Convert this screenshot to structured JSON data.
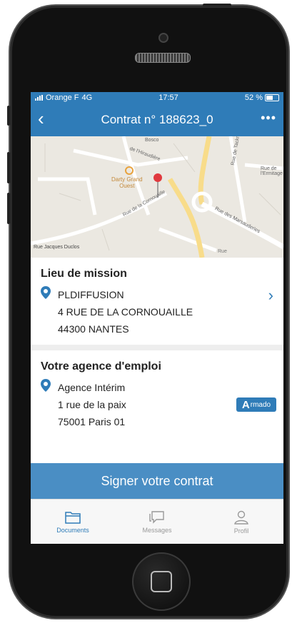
{
  "status_bar": {
    "carrier": "Orange F",
    "network": "4G",
    "time": "17:57",
    "battery": "52 %"
  },
  "header": {
    "title": "Contrat n° 188623_0",
    "more": "•••"
  },
  "map_labels": {
    "poi": "Darty Grand\nOuest",
    "street1": "Rue de la Cornouaille",
    "street2": "Rue des Marsauderies",
    "street3": "Rue de Tackrc",
    "street4": "Rue de l'Ermitage",
    "street5": "Rue Jacques Duclos",
    "street6": "de l'Hiraudière",
    "street7": "Rue de la Cornouaille",
    "street8": "Rue",
    "area": "Bosco"
  },
  "mission": {
    "heading": "Lieu de mission",
    "line1": "PLDIFFUSION",
    "line2": "4 RUE DE LA CORNOUAILLE",
    "line3": "44300 NANTES"
  },
  "agency": {
    "heading": "Votre agence d'emploi",
    "line1": "Agence Intérim",
    "line2": "1 rue de la paix",
    "line3": "75001 Paris 01",
    "logo_letter": "A",
    "logo_text": "rmado"
  },
  "cta_label": "Signer votre contrat",
  "tabs": [
    {
      "label": "Documents",
      "icon": "folder-icon"
    },
    {
      "label": "Messages",
      "icon": "chat-icon"
    },
    {
      "label": "Profil",
      "icon": "user-icon"
    }
  ],
  "colors": {
    "primary": "#2f7cb8",
    "cta": "#4a8ec4",
    "pin": "#e0393e"
  }
}
